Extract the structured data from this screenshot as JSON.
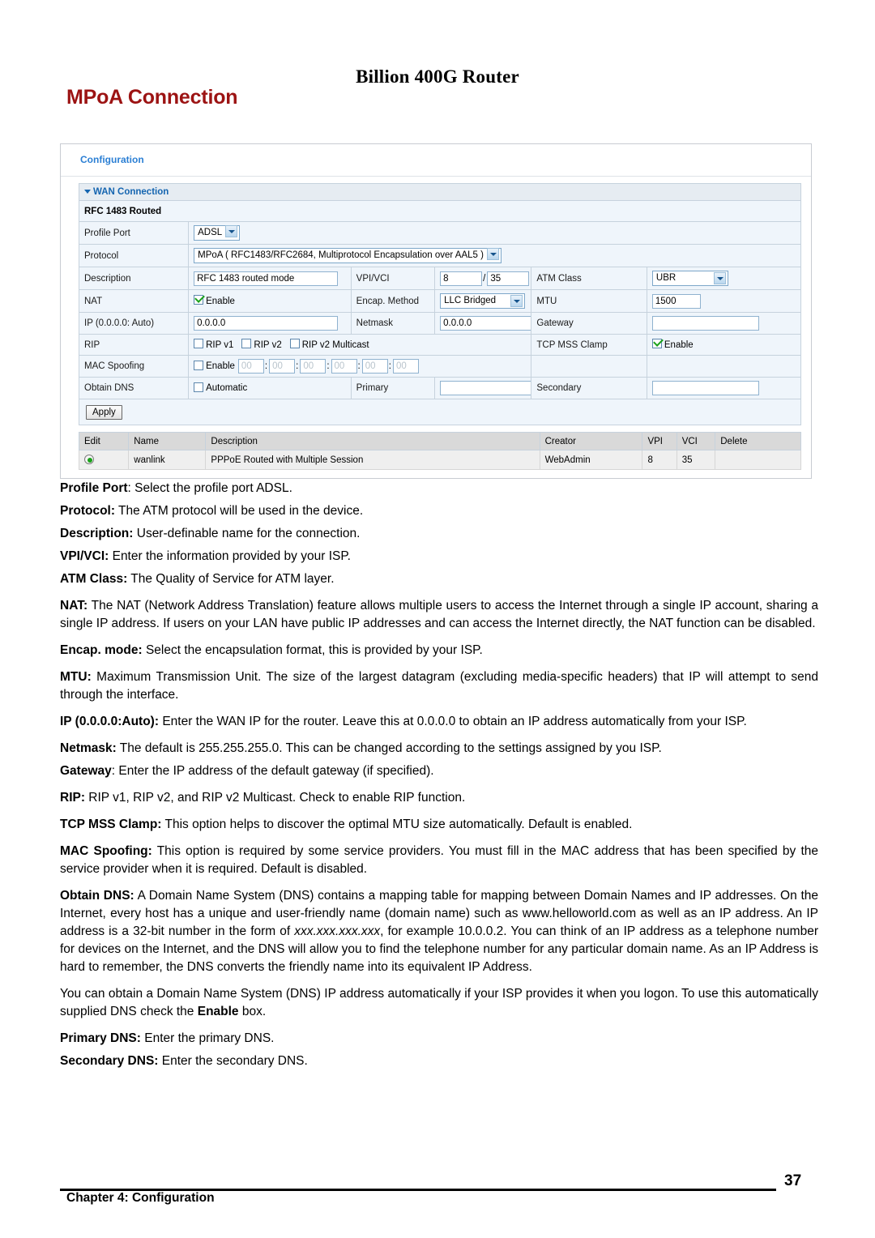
{
  "header": {
    "doc_title": "Billion 400G Router",
    "section_title": "MPoA Connection"
  },
  "panel": {
    "title": "Configuration",
    "wan_section": "WAN Connection",
    "subsection": "RFC 1483 Routed",
    "rows": {
      "profile_port_label": "Profile Port",
      "profile_port_value": "ADSL",
      "protocol_label": "Protocol",
      "protocol_value": "MPoA ( RFC1483/RFC2684, Multiprotocol Encapsulation over AAL5 )",
      "description_label": "Description",
      "description_value": "RFC 1483 routed mode",
      "vpivci_label": "VPI/VCI",
      "vpi_value": "8",
      "vci_value": "35",
      "vpivci_separator": "/",
      "atm_class_label": "ATM Class",
      "atm_class_value": "UBR",
      "nat_label": "NAT",
      "nat_checkbox_label": "Enable",
      "nat_checked": true,
      "encap_label": "Encap. Method",
      "encap_value": "LLC Bridged",
      "mtu_label": "MTU",
      "mtu_value": "1500",
      "ip_label": "IP (0.0.0.0: Auto)",
      "ip_value": "0.0.0.0",
      "netmask_label": "Netmask",
      "netmask_value": "0.0.0.0",
      "gateway_label": "Gateway",
      "gateway_value": "",
      "rip_label": "RIP",
      "rip_v1_label": "RIP v1",
      "rip_v2_label": "RIP v2",
      "rip_v2_multicast_label": "RIP v2 Multicast",
      "tcp_mss_label": "TCP MSS Clamp",
      "tcp_mss_checkbox_label": "Enable",
      "tcp_mss_checked": true,
      "mac_spoofing_label": "MAC Spoofing",
      "mac_spoofing_checkbox_label": "Enable",
      "mac_octets": [
        "00",
        "00",
        "00",
        "00",
        "00",
        "00"
      ],
      "mac_separator": ":",
      "obtain_dns_label": "Obtain DNS",
      "obtain_dns_checkbox_label": "Automatic",
      "primary_label": "Primary",
      "primary_value": "",
      "secondary_label": "Secondary",
      "secondary_value": ""
    },
    "apply_button": "Apply",
    "list_table": {
      "columns": [
        "Edit",
        "Name",
        "Description",
        "Creator",
        "VPI",
        "VCI",
        "Delete"
      ],
      "rows": [
        {
          "edit": "",
          "name": "wanlink",
          "description": "PPPoE Routed with Multiple Session",
          "creator": "WebAdmin",
          "vpi": "8",
          "vci": "35",
          "delete": ""
        }
      ]
    }
  },
  "prose": {
    "p1_label": "Profile Port",
    "p1_text": ": Select the profile port ADSL.",
    "p2_label": "Protocol:",
    "p2_text": " The ATM protocol will be used in the device.",
    "p3_label": "Description:",
    "p3_text": " User-definable name for the connection.",
    "p4_label": "VPI/VCI:",
    "p4_text": " Enter the information provided by your ISP.",
    "p5_label": "ATM Class:",
    "p5_text": " The Quality of Service for ATM layer.",
    "p6_label": "NAT:",
    "p6_text": " The NAT (Network Address Translation) feature allows multiple users to access the Internet through a single IP account, sharing a single IP address. If users on your LAN have public IP addresses and can access the Internet directly, the NAT function can be disabled.",
    "p7_label": "Encap. mode:",
    "p7_text": " Select the encapsulation format, this is provided by your ISP.",
    "p8_label": "MTU:",
    "p8_text": " Maximum Transmission Unit. The size of the largest datagram (excluding media-specific headers) that IP will attempt to send through the interface.",
    "p9_label": "IP (0.0.0.0:Auto):",
    "p9_text": " Enter the WAN IP for the router. Leave this at 0.0.0.0 to obtain an IP address automatically from your ISP.",
    "p10_label": "Netmask:",
    "p10_text": " The default is 255.255.255.0. This can be changed according to the settings assigned by you ISP.",
    "p11_label": "Gateway",
    "p11_text": ": Enter the IP address of the default gateway (if specified).",
    "p12_label": "RIP:",
    "p12_text": " RIP v1, RIP v2, and RIP v2 Multicast. Check to enable RIP function.",
    "p13_label": "TCP MSS Clamp:",
    "p13_text": " This option helps to discover the optimal MTU size automatically. Default is enabled.",
    "p14_label": "MAC Spoofing:",
    "p14_text": " This option is required by some service providers. You must fill in the MAC address that has been specified by the service provider when it is required. Default is disabled.",
    "p15_label": "Obtain DNS:",
    "p15_text_a": " A Domain Name System (DNS) contains a mapping table for mapping between Domain Names and IP addresses. On the Internet, every host has a unique and user-friendly name (domain name) such as www.helloworld.com as well as an IP address. An IP address is a 32-bit number in the form of ",
    "p15_italic": "xxx.xxx.xxx.xxx",
    "p15_text_b": ", for example 10.0.0.2. You can think of an IP address as a telephone number for devices on the Internet, and the DNS will allow you to find the telephone number for any particular domain name. As an IP Address is hard to remember, the DNS converts the friendly name into its equivalent IP Address.",
    "p16_text_a": "You can obtain a Domain Name System (DNS) IP address automatically if your ISP provides it when you logon. To use this automatically supplied DNS check the ",
    "p16_bold": "Enable",
    "p16_text_b": " box.",
    "p17_label": "Primary DNS:",
    "p17_text": " Enter the primary DNS.",
    "p18_label": "Secondary DNS:",
    "p18_text": " Enter the secondary DNS."
  },
  "footer": {
    "chapter": "Chapter 4: Configuration",
    "page_number": "37"
  }
}
